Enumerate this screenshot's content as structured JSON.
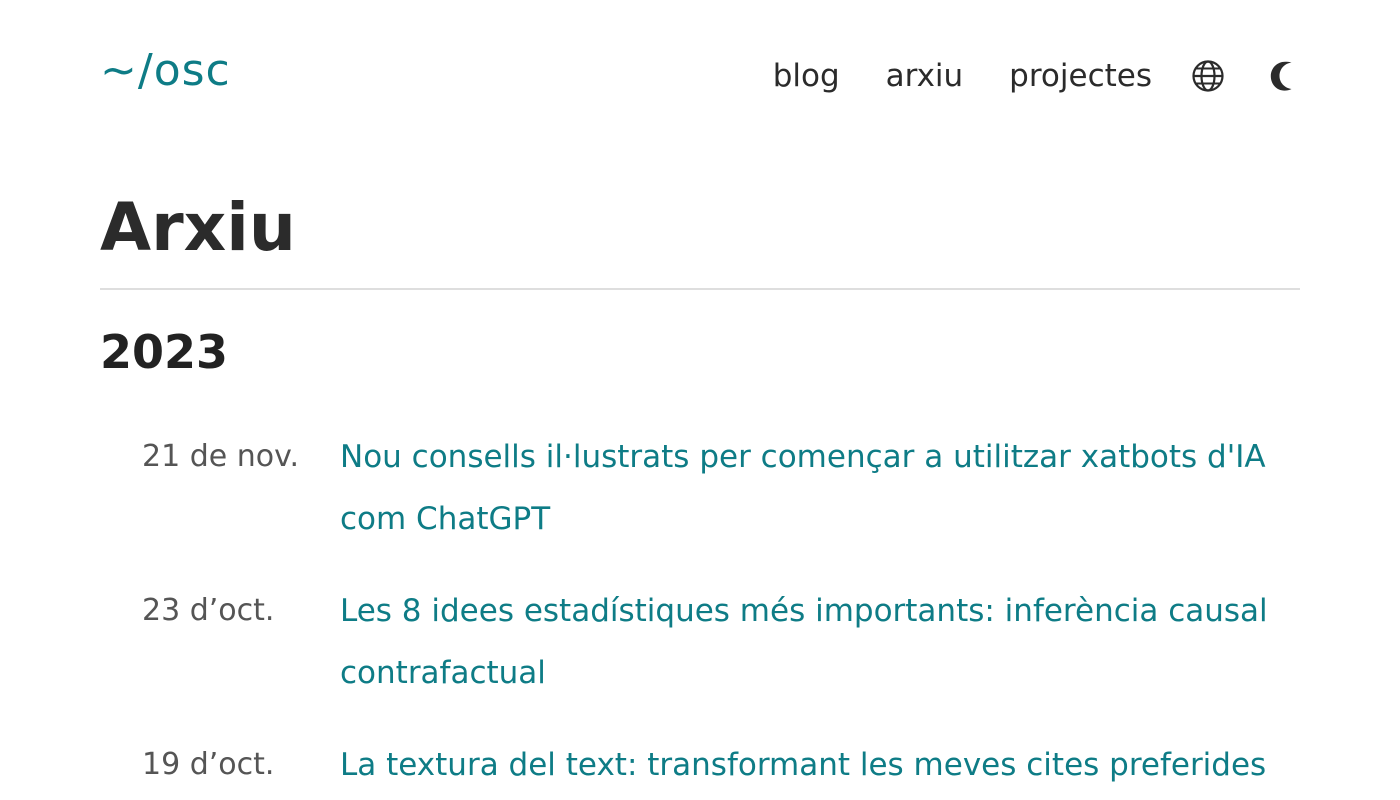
{
  "header": {
    "logo": "~/osc",
    "nav": [
      {
        "label": "blog"
      },
      {
        "label": "arxiu"
      },
      {
        "label": "projectes"
      }
    ],
    "icons": {
      "language": "globe-icon",
      "theme": "moon-icon"
    }
  },
  "main": {
    "title": "Arxiu",
    "sections": [
      {
        "year": "2023",
        "posts": [
          {
            "date": "21 de nov.",
            "title": "Nou consells il·lustrats per començar a utilitzar xatbots d'IA com ChatGPT"
          },
          {
            "date": "23 d’oct.",
            "title": "Les 8 idees estadístiques més importants: inferència causal contrafactual"
          },
          {
            "date": "19 d’oct.",
            "title": "La textura del text: transformant les meves cites preferides"
          }
        ]
      }
    ]
  },
  "colors": {
    "accent": "#0e7c86",
    "text": "#2b2b2b",
    "muted": "#555555",
    "divider": "#dedede"
  }
}
